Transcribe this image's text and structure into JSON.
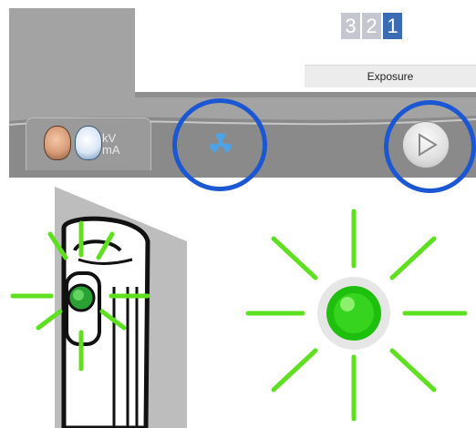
{
  "panel": {
    "steps": [
      "3",
      "2",
      "1"
    ],
    "active_step_index": 2,
    "exposure_label": "Exposure",
    "kv_label": "kV",
    "ma_label": "mA"
  },
  "icons": {
    "patient_head": "patient-head-icon",
    "technician_head": "technician-head-icon",
    "radiation": "radiation-icon",
    "play": "play-icon",
    "exposure_light": "exposure-light-icon"
  },
  "colors": {
    "highlight_circle": "#1b57d3",
    "active_step": "#3a6bb3",
    "glow": "#5ee021",
    "light_center": "#22c40f"
  }
}
